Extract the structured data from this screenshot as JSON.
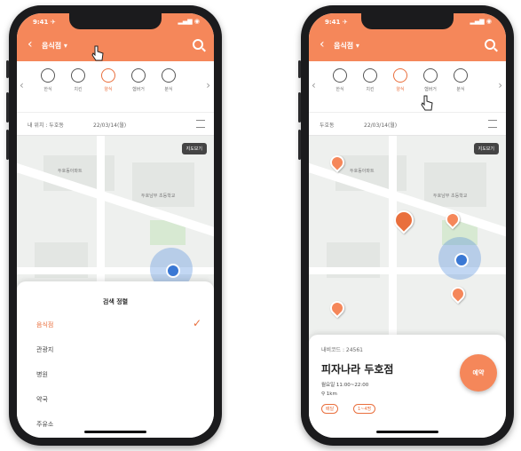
{
  "left_phone": {
    "header": {
      "title": "음식점 ▾"
    },
    "categories": [
      {
        "label": "한식"
      },
      {
        "label": "치킨"
      },
      {
        "label": "양식"
      },
      {
        "label": "햄버거"
      },
      {
        "label": "분식"
      }
    ],
    "filters": {
      "location": "내 위치 : 두호동",
      "date": "22/03/14(월)"
    },
    "map": {
      "view_button": "지도보기"
    },
    "sheet": {
      "title": "검색 정렬",
      "options": [
        "음식점",
        "관광지",
        "병원",
        "약국",
        "주유소"
      ],
      "selected_index": 0
    }
  },
  "right_phone": {
    "header": {
      "title": "음식점 ▾"
    },
    "categories": [
      {
        "label": "한식"
      },
      {
        "label": "치킨"
      },
      {
        "label": "양식"
      },
      {
        "label": "햄버거"
      },
      {
        "label": "분식"
      }
    ],
    "filters": {
      "location": "두호동",
      "date": "22/03/14(월)"
    },
    "map": {
      "view_button": "지도보기"
    },
    "card": {
      "code": "내비코드 : 24561",
      "name": "피자나라 두호점",
      "hours": "월요일 11:00~22:00",
      "distance": "1km",
      "tags": [
        "배달",
        "1~4명"
      ],
      "reserve_label": "예약"
    }
  },
  "colors": {
    "accent": "#f5875a",
    "accent_dark": "#e96f3d"
  }
}
